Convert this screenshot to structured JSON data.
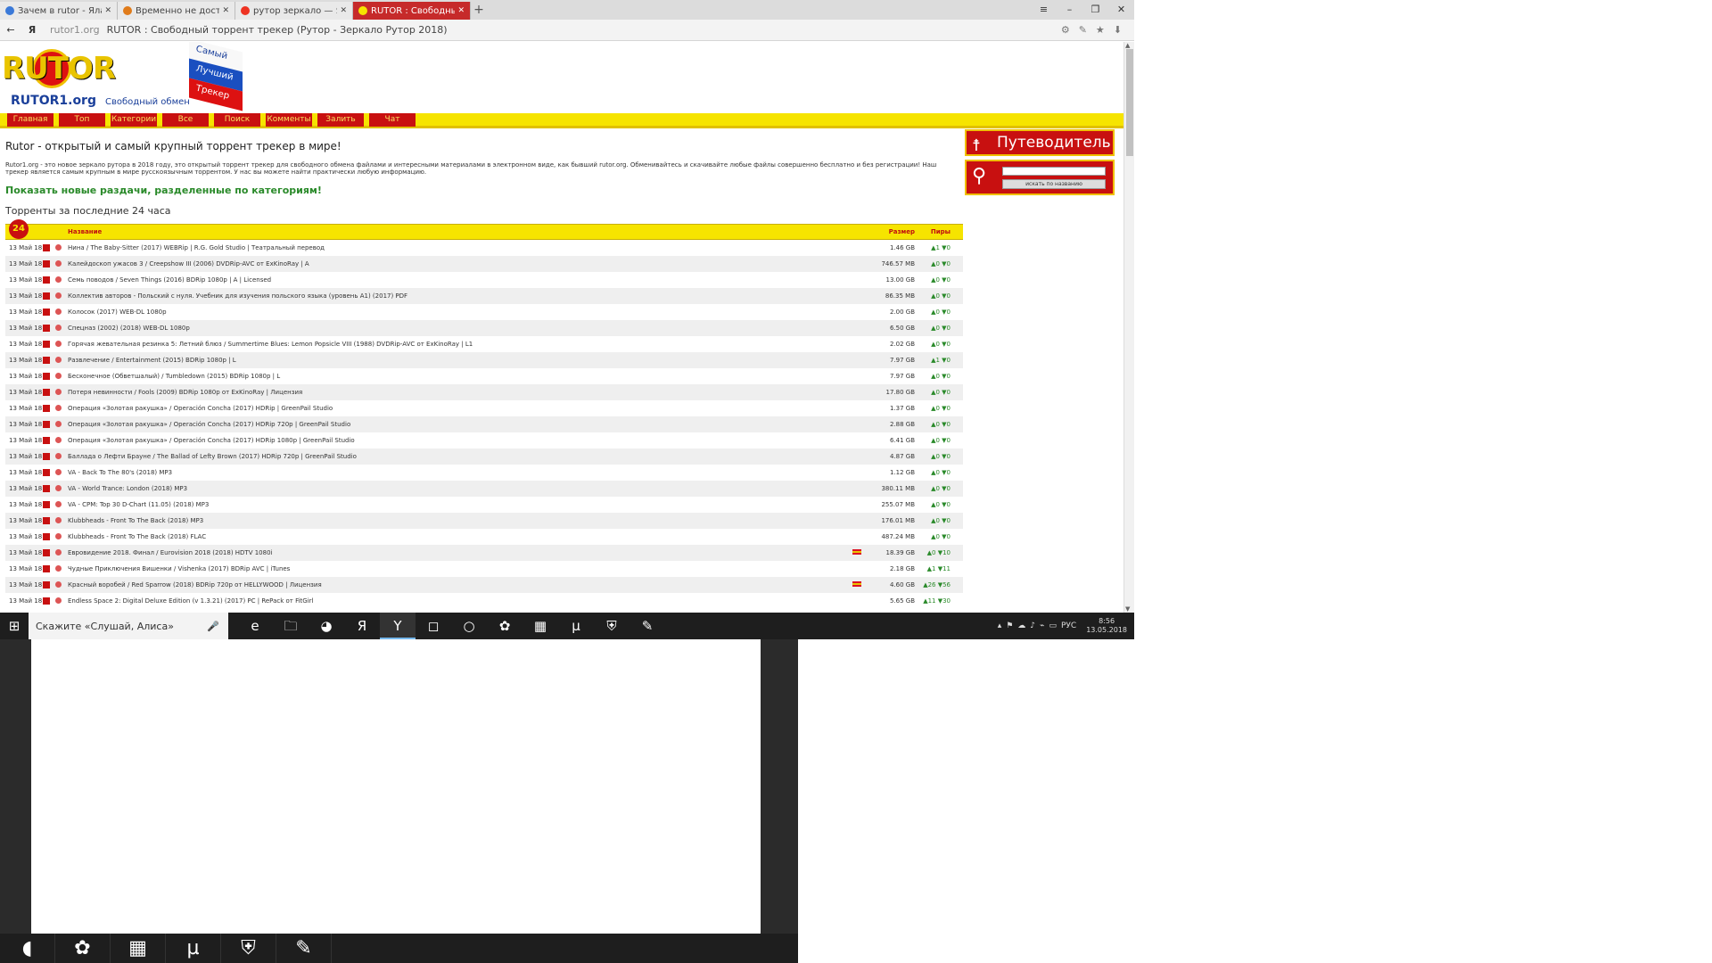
{
  "browser": {
    "tabs": [
      {
        "label": "Зачем в rutor - Ялакала",
        "close": "✕",
        "color": "#3a79d8",
        "active": false
      },
      {
        "label": "Временно не доступна",
        "close": "✕",
        "color": "#e07b1a",
        "active": false
      },
      {
        "label": "рутор зеркало — Яндекс",
        "close": "✕",
        "color": "#e32",
        "active": false
      },
      {
        "label": "RUTOR : Свободный тор",
        "close": "✕",
        "color": "#f6e400",
        "active": true
      }
    ],
    "new_tab": "+",
    "window_controls": [
      "≡",
      "–",
      "❐",
      "✕"
    ],
    "nav_back": "←",
    "yandex_button": "Я",
    "url_domain": "rutor1.org",
    "url_title": "RUTOR : Свободный торрент трекер (Рутор - Зеркало Рутор 2018)",
    "tool_icons": [
      "⚙",
      "✎",
      "★",
      "⬇"
    ]
  },
  "logo": {
    "wordmark": "RUTOR",
    "domain": "RUTOR1.org",
    "tagline": "Свободный обмен",
    "flag_words": [
      "Самый",
      "Лучший",
      "Трекер"
    ]
  },
  "menu": [
    "Главная",
    "Топ",
    "Категории",
    "Все",
    "Поиск",
    "Комменты",
    "Залить",
    "Чат"
  ],
  "page": {
    "heading": "Rutor - открытый и самый крупный торрент трекер в мире!",
    "intro": "Rutor1.org - это новое зеркало рутора в 2018 году, это открытый торрент трекер для свободного обмена файлами и интересными материалами в электронном виде, как бывший rutor.org. Обменивайтесь и скачивайте любые файлы совершенно бесплатно и без регистрации! Наш трекер является самым крупным в мире русскоязычным торрентом. У нас вы можете найти практически любую информацию.",
    "show_new": "Показать новые раздачи, разделенные по категориям!",
    "last24": "Торренты за последние 24 часа",
    "badge": "24"
  },
  "table": {
    "headers": {
      "name": "Название",
      "size": "Размер",
      "peers": "Пиры"
    },
    "rows": [
      {
        "date": "13 Май 18",
        "name": "Нина / The Baby-Sitter (2017) WEBRip | R.G. Gold Studio | Театральный перевод",
        "size": "1.46 GB",
        "peers": "▲1 ▼0",
        "flag": false
      },
      {
        "date": "13 Май 18",
        "name": "Калейдоскоп ужасов 3 / Creepshow III (2006) DVDRip-AVC от ExKinoRay | A",
        "size": "746.57 MB",
        "peers": "▲0 ▼0",
        "flag": false
      },
      {
        "date": "13 Май 18",
        "name": "Семь поводов / Seven Things (2016) BDRip 1080p | A | Licensed",
        "size": "13.00 GB",
        "peers": "▲0 ▼0",
        "flag": false
      },
      {
        "date": "13 Май 18",
        "name": "Коллектив авторов - Польский с нуля. Учебник для изучения польского языка (уровень A1) (2017) PDF",
        "size": "86.35 MB",
        "peers": "▲0 ▼0",
        "flag": false
      },
      {
        "date": "13 Май 18",
        "name": "Колосок (2017) WEB-DL 1080p",
        "size": "2.00 GB",
        "peers": "▲0 ▼0",
        "flag": false
      },
      {
        "date": "13 Май 18",
        "name": "Спецназ (2002) (2018) WEB-DL 1080p",
        "size": "6.50 GB",
        "peers": "▲0 ▼0",
        "flag": false
      },
      {
        "date": "13 Май 18",
        "name": "Горячая жевательная резинка 5: Летний блюз / Summertime Blues: Lemon Popsicle VIII (1988) DVDRip-AVC от ExKinoRay | L1",
        "size": "2.02 GB",
        "peers": "▲0 ▼0",
        "flag": false
      },
      {
        "date": "13 Май 18",
        "name": "Развлечение / Entertainment (2015) BDRip 1080p | L",
        "size": "7.97 GB",
        "peers": "▲1 ▼0",
        "flag": false
      },
      {
        "date": "13 Май 18",
        "name": "Бесконечное (Обветшалый) / Tumbledown (2015) BDRip 1080p | L",
        "size": "7.97 GB",
        "peers": "▲0 ▼0",
        "flag": false
      },
      {
        "date": "13 Май 18",
        "name": "Потеря невинности / Fools (2009) BDRip 1080p от ExKinoRay | Лицензия",
        "size": "17.80 GB",
        "peers": "▲0 ▼0",
        "flag": false
      },
      {
        "date": "13 Май 18",
        "name": "Операция «Золотая ракушка» / Operación Concha (2017) HDRip | GreenPail Studio",
        "size": "1.37 GB",
        "peers": "▲0 ▼0",
        "flag": false
      },
      {
        "date": "13 Май 18",
        "name": "Операция «Золотая ракушка» / Operación Concha (2017) HDRip 720p | GreenPail Studio",
        "size": "2.88 GB",
        "peers": "▲0 ▼0",
        "flag": false
      },
      {
        "date": "13 Май 18",
        "name": "Операция «Золотая ракушка» / Operación Concha (2017) HDRip 1080p | GreenPail Studio",
        "size": "6.41 GB",
        "peers": "▲0 ▼0",
        "flag": false
      },
      {
        "date": "13 Май 18",
        "name": "Баллада о Лефти Брауне / The Ballad of Lefty Brown (2017) HDRip 720p | GreenPail Studio",
        "size": "4.87 GB",
        "peers": "▲0 ▼0",
        "flag": false
      },
      {
        "date": "13 Май 18",
        "name": "VA - Back To The 80's (2018) MP3",
        "size": "1.12 GB",
        "peers": "▲0 ▼0",
        "flag": false
      },
      {
        "date": "13 Май 18",
        "name": "VA - World Trance: London (2018) MP3",
        "size": "380.11 MB",
        "peers": "▲0 ▼0",
        "flag": false
      },
      {
        "date": "13 Май 18",
        "name": "VA - CPM: Top 30 D-Chart (11.05) (2018) MP3",
        "size": "255.07 MB",
        "peers": "▲0 ▼0",
        "flag": false
      },
      {
        "date": "13 Май 18",
        "name": "Klubbheads - Front To The Back (2018) MP3",
        "size": "176.01 MB",
        "peers": "▲0 ▼0",
        "flag": false
      },
      {
        "date": "13 Май 18",
        "name": "Klubbheads - Front To The Back (2018) FLAC",
        "size": "487.24 MB",
        "peers": "▲0 ▼0",
        "flag": false
      },
      {
        "date": "13 Май 18",
        "name": "Евровидение 2018. Финал / Eurovision 2018 (2018) HDTV 1080i",
        "size": "18.39 GB",
        "peers": "▲0 ▼10",
        "flag": true
      },
      {
        "date": "13 Май 18",
        "name": "Чудные Приключения Вишенки / Vishenka (2017) BDRip AVC | iTunes",
        "size": "2.18 GB",
        "peers": "▲1 ▼11",
        "flag": false
      },
      {
        "date": "13 Май 18",
        "name": "Красный воробей / Red Sparrow (2018) BDRip 720p от HELLYWOOD | Лицензия",
        "size": "4.60 GB",
        "peers": "▲26 ▼56",
        "flag": true
      },
      {
        "date": "13 Май 18",
        "name": "Endless Space 2: Digital Deluxe Edition (v 1.3.21) (2017) PC | RePack от FitGirl",
        "size": "5.65 GB",
        "peers": "▲11 ▼30",
        "flag": false
      }
    ]
  },
  "sidebar": {
    "guide": "Путеводитель",
    "search_button": "искать по названию"
  },
  "taskbar": {
    "start": "⊞",
    "search_text": "Скажите «Слушай, Алиса»",
    "mic": "🎤",
    "apps": [
      "e",
      "🗀",
      "◕",
      "Я",
      "Y",
      "◻",
      "○",
      "✿",
      "▦",
      "µ",
      "⛨",
      "✎"
    ],
    "tray_icons": [
      "▴",
      "⚑",
      "☁",
      "♪",
      "⌁",
      "▭"
    ],
    "lang": "РУС",
    "time": "8:56",
    "date": "13.05.2018"
  },
  "ghost_taskbar": [
    "◖",
    "✿",
    "▦",
    "µ",
    "⛨",
    "✎"
  ]
}
